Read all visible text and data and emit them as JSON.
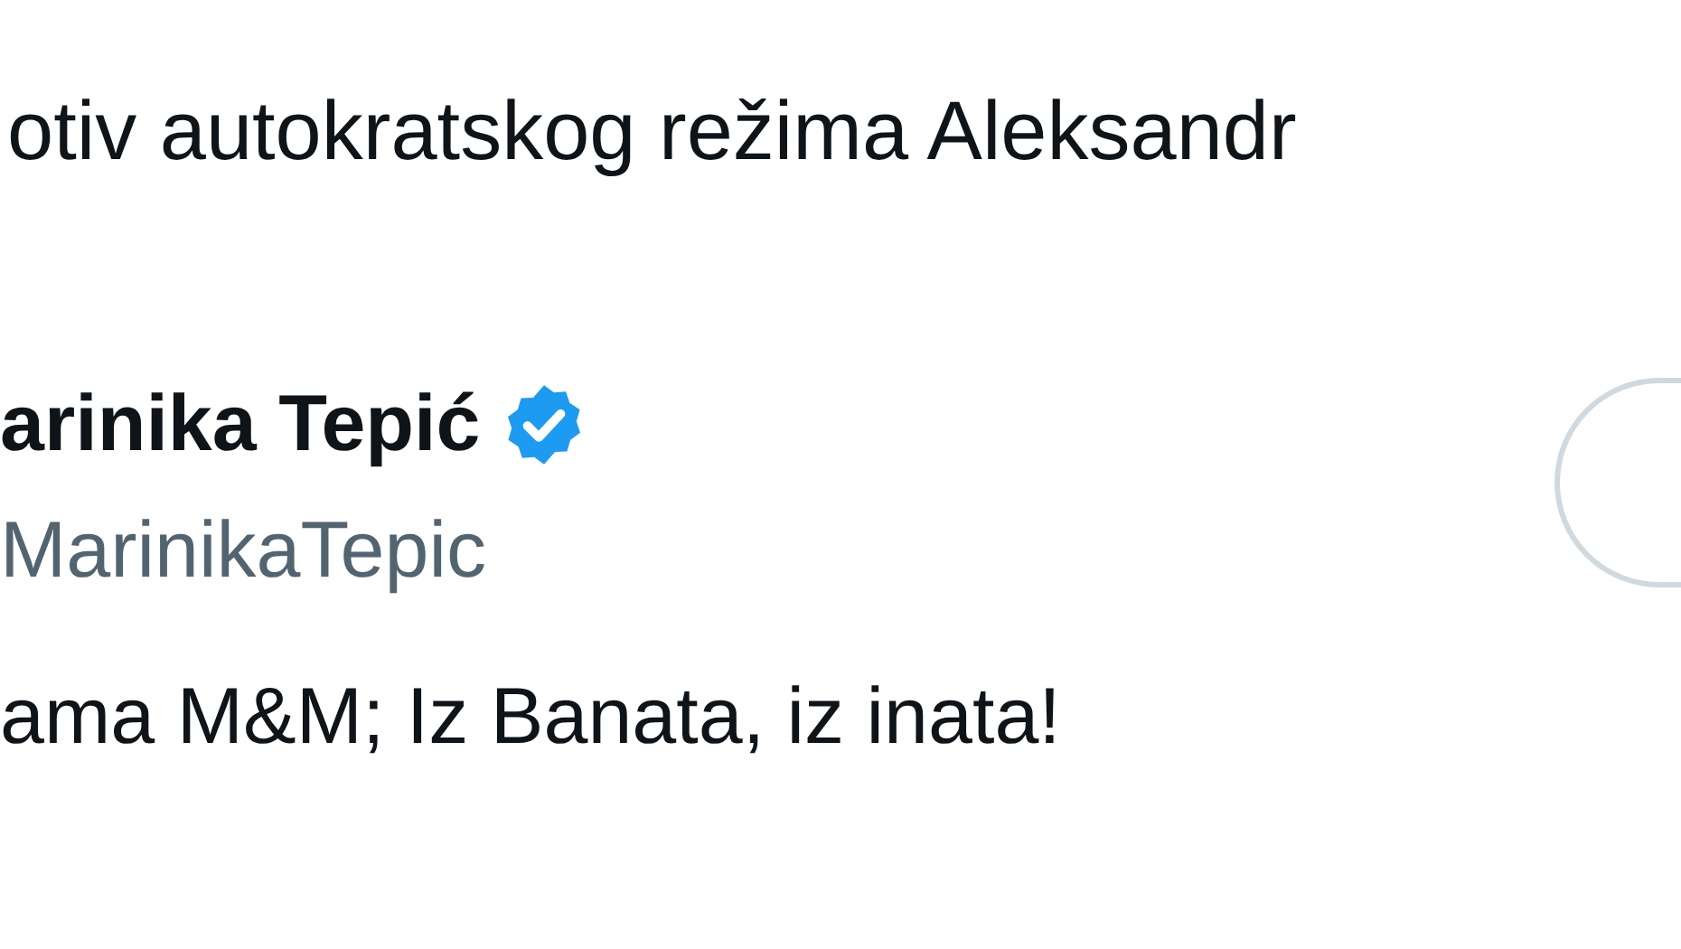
{
  "previous_tweet": {
    "text": "otiv autokratskog režima Aleksandr"
  },
  "tweet": {
    "author_name": "arinika Tepić",
    "verified": true,
    "handle": "MarinikaTepic",
    "text": "ama M&M; Iz Banata, iz inata!"
  }
}
